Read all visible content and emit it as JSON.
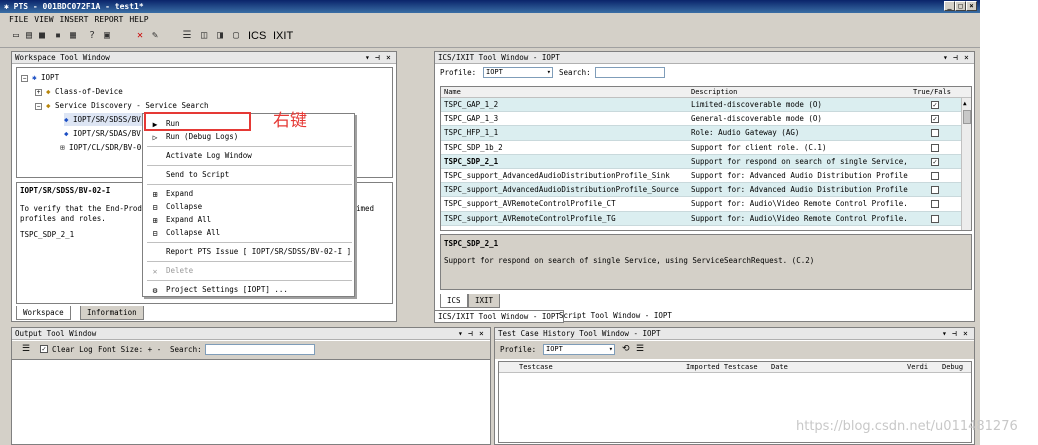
{
  "window": {
    "title": "PTS - 001BDC072F1A - test1*"
  },
  "menubar": [
    "FILE",
    "VIEW",
    "INSERT",
    "REPORT",
    "HELP"
  ],
  "toolbar": {
    "ics_label": "ICS",
    "ixit_label": "IXIT"
  },
  "workspace": {
    "title": "Workspace Tool Window",
    "tree": {
      "root": "IOPT",
      "class_of_device": "Class-of-Device",
      "service_discovery": "Service Discovery - Service Search",
      "items": [
        "IOPT/SR/SDSS/BV-0",
        "IOPT/SR/SDAS/BV-0",
        "IOPT/CL/SDR/BV-0"
      ]
    },
    "desc_title": "IOPT/SR/SDSS/BV-02-I",
    "desc_text1": "To verify that the End-Produc",
    "desc_text1_right": "imed",
    "desc_text2": "profiles and roles.",
    "desc_ref": "TSPC_SDP_2_1",
    "tabs": [
      "Workspace",
      "Information"
    ]
  },
  "annotation": "右键",
  "context_menu": {
    "run": "Run",
    "run_debug": "Run (Debug Logs)",
    "activate_log": "Activate Log Window",
    "send_script": "Send to Script",
    "expand": "Expand",
    "collapse": "Collapse",
    "expand_all": "Expand All",
    "collapse_all": "Collapse All",
    "report_issue": "Report PTS Issue [ IOPT/SR/SDSS/BV-02-I ]",
    "delete": "Delete",
    "project_settings": "Project Settings [IOPT] ..."
  },
  "ics": {
    "title": "ICS/IXIT Tool Window - IOPT",
    "profile_label": "Profile:",
    "profile_value": "IOPT",
    "search_label": "Search:",
    "headers": [
      "Name",
      "Description",
      "True/Fals"
    ],
    "rows": [
      {
        "name": "TSPC_GAP_1_2",
        "desc": "Limited-discoverable mode (O)",
        "checked": true
      },
      {
        "name": "TSPC_GAP_1_3",
        "desc": "General-discoverable mode (O)",
        "checked": true
      },
      {
        "name": "TSPC_HFP_1_1",
        "desc": "Role: Audio Gateway (AG)",
        "checked": false
      },
      {
        "name": "TSPC_SDP_1b_2",
        "desc": "Support for client role. (C.1)",
        "checked": false
      },
      {
        "name": "TSPC_SDP_2_1",
        "desc": "Support for respond on search of single Service, us",
        "checked": true
      },
      {
        "name": "TSPC_support_AdvancedAudioDistributionProfile_Sink",
        "desc": "Support for: Advanced Audio Distribution Profile.",
        "checked": false
      },
      {
        "name": "TSPC_support_AdvancedAudioDistributionProfile_Source",
        "desc": "Support for: Advanced Audio Distribution Profile.",
        "checked": false
      },
      {
        "name": "TSPC_support_AVRemoteControlProfile_CT",
        "desc": "Support for: Audio\\Video Remote Control Profile.",
        "checked": false
      },
      {
        "name": "TSPC_support_AVRemoteControlProfile_TG",
        "desc": "Support for: Audio\\Video Remote Control Profile.",
        "checked": false
      }
    ],
    "detail_title": "TSPC_SDP_2_1",
    "detail_text": "Support for respond on search of single Service, using ServiceSearchRequest. (C.2)",
    "tabs": [
      "ICS",
      "IXIT"
    ],
    "bottom_tabs": [
      "ICS/IXIT Tool Window - IOPT",
      "Script Tool Window - IOPT"
    ]
  },
  "output": {
    "title": "Output Tool Window",
    "clear_log": "Clear Log",
    "font_size": "Font Size: + -",
    "search_label": "Search:"
  },
  "history": {
    "title": "Test Case History Tool Window - IOPT",
    "profile_label": "Profile:",
    "profile_value": "IOPT",
    "headers": [
      "Testcase",
      "Imported Testcase",
      "Date",
      "Verdi",
      "Debug"
    ]
  },
  "watermark": "https://blog.csdn.net/u011481276"
}
